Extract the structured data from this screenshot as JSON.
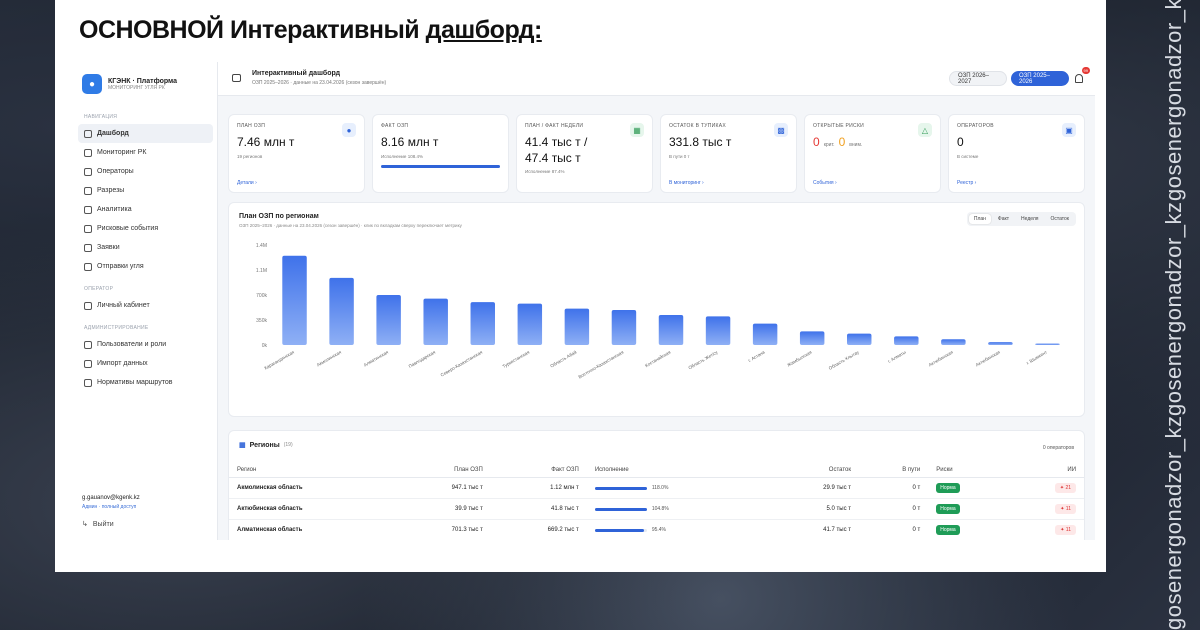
{
  "slide": {
    "title_plain": "ОСНОВНОЙ Интерактивный",
    "title_underlined": "дашборд:",
    "handle_1": "gosenergonadzor_kz",
    "handle_2": "gosenergonadzor_kz",
    "handle_3": "gosenergonadzor_kz"
  },
  "brand": {
    "name": "КГЭНК · Платформа",
    "sub": "МОНИТОРИНГ УГЛЯ РК"
  },
  "sidebar": {
    "section_nav": "НАВИГАЦИЯ",
    "nav_items": [
      {
        "label": "Дашборд",
        "icon": "dashboard-icon"
      },
      {
        "label": "Мониторинг РК",
        "icon": "monitor-icon"
      },
      {
        "label": "Операторы",
        "icon": "operators-icon"
      },
      {
        "label": "Разрезы",
        "icon": "mine-icon"
      },
      {
        "label": "Аналитика",
        "icon": "analytics-icon"
      },
      {
        "label": "Рисковые события",
        "icon": "risk-icon"
      },
      {
        "label": "Заявки",
        "icon": "requests-icon"
      },
      {
        "label": "Отправки угля",
        "icon": "shipments-icon"
      }
    ],
    "section_operator": "ОПЕРАТОР",
    "operator_items": [
      {
        "label": "Личный кабинет"
      }
    ],
    "section_admin": "АДМИНИСТРИРОВАНИЕ",
    "admin_items": [
      {
        "label": "Пользователи и роли"
      },
      {
        "label": "Импорт данных"
      },
      {
        "label": "Нормативы маршрутов"
      }
    ],
    "email": "g.gauanov@kgenk.kz",
    "role": "Админ · полный доступ",
    "logout": "Выйти"
  },
  "topbar": {
    "title": "Интерактивный дашборд",
    "subtitle": "ОЗП 2025–2026 · данные на 23.04.2026 (сезон завершён)",
    "season_a": "ОЗП 2026–2027",
    "season_b": "ОЗП 2025–2026",
    "notifications": "99"
  },
  "cards": [
    {
      "title": "ПЛАН ОЗП",
      "value": "7.46 млн т",
      "sub": "19 регионов",
      "link": "Детали"
    },
    {
      "title": "ФАКТ ОЗП",
      "value": "8.16 млн т",
      "sub": "Исполнение 108.4%"
    },
    {
      "title": "ПЛАН / ФАКТ НЕДЕЛИ",
      "value": "41.4 тыс т /",
      "value2": "47.4 тыс т",
      "sub": "Исполнение 87.4%"
    },
    {
      "title": "ОСТАТОК В ТУПИКАХ",
      "value": "331.8 тыс т",
      "sub": "В пути 0 т",
      "link": "В мониторинг"
    },
    {
      "title": "ОТКРЫТЫЕ РИСКИ",
      "crit": "0",
      "crit_label": "крит.",
      "warn": "0",
      "warn_label": "вним.",
      "link": "События"
    },
    {
      "title": "ОПЕРАТОРОВ",
      "value": "0",
      "sub": "В системе",
      "link": "Реестр"
    }
  ],
  "fact_progress_pct": 100,
  "chart": {
    "title": "План ОЗП по регионам",
    "subtitle": "ОЗП 2025–2026 · данные на 23.04.2026 (сезон завершён) · клик по вкладкам сверху переключает метрику",
    "tabs": [
      "План",
      "Факт",
      "Неделя",
      "Остаток"
    ],
    "active_tab": "План"
  },
  "chart_data": {
    "type": "bar",
    "title": "План ОЗП по регионам",
    "categories": [
      "Карагандинская",
      "Акмолинская",
      "Алматинская",
      "Павлодарская",
      "Северо-Казахстанская",
      "Туркестанская",
      "Область Абай",
      "Восточно-Казахстанская",
      "Костанайская",
      "Область Жетісу",
      "г. Астана",
      "Жамбылская",
      "Область Ұлытау",
      "г. Алматы",
      "Актюбинская",
      "Актюбинская",
      "г. Шымкент"
    ],
    "series": [
      {
        "values": [
          1250000,
          940000,
          700000,
          650000,
          600000,
          580000,
          510000,
          490000,
          420000,
          400000,
          300000,
          190000,
          160000,
          120000,
          80000,
          40000,
          20000
        ]
      }
    ],
    "yticks": [
      "1.4M",
      "1.1M",
      "700k",
      "350k",
      "0k"
    ],
    "ylim": [
      0,
      1400000
    ],
    "bar_color": "#3f72ea"
  },
  "table": {
    "title": "Регионы",
    "count": "(19)",
    "operators": "0 операторов",
    "headers": [
      "Регион",
      "План ОЗП",
      "Факт ОЗП",
      "Исполнение",
      "Остаток",
      "В пути",
      "Риски",
      "ИИ"
    ],
    "rows": [
      {
        "region": "Акмолинская область",
        "plan": "947.1 тыс т",
        "fact": "1.12 млн т",
        "pct": "118.0%",
        "pct_val": 100,
        "rest": "29.9 тыс т",
        "transit": "0 т",
        "risk": "Норма",
        "ai": "21"
      },
      {
        "region": "Актюбинская область",
        "plan": "39.9 тыс т",
        "fact": "41.8 тыс т",
        "pct": "104.8%",
        "pct_val": 100,
        "rest": "5.0 тыс т",
        "transit": "0 т",
        "risk": "Норма",
        "ai": "11"
      },
      {
        "region": "Алматинская область",
        "plan": "701.3 тыс т",
        "fact": "669.2 тыс т",
        "pct": "95.4%",
        "pct_val": 95,
        "rest": "41.7 тыс т",
        "transit": "0 т",
        "risk": "Норма",
        "ai": "11"
      }
    ]
  }
}
